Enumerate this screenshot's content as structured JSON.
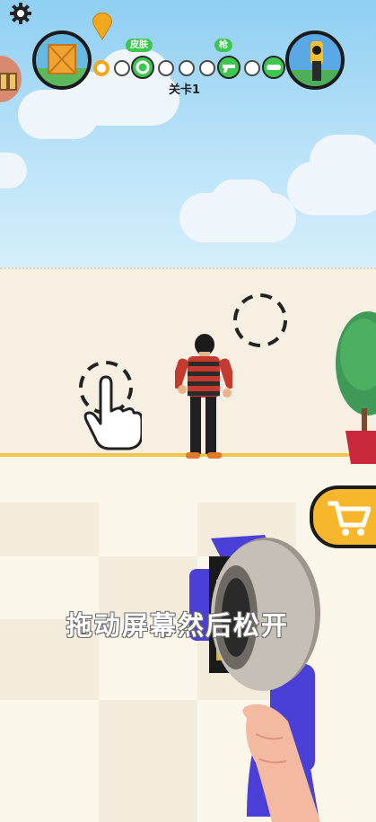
{
  "hud": {
    "level_label": "关卡1",
    "progress_badges": [
      "皮肤",
      "枪"
    ],
    "settings_icon": "gear-icon",
    "location_marker": "map-pin-icon",
    "left_reward": "crate-icon",
    "right_reward": "drill-gun-icon"
  },
  "tutorial": {
    "instruction": "拖动屏幕然后松开"
  },
  "shop": {
    "icon": "shopping-cart-icon"
  },
  "colors": {
    "accent_green": "#3cc84e",
    "accent_yellow": "#f6b72c",
    "gun_blue": "#4a3fd6"
  }
}
